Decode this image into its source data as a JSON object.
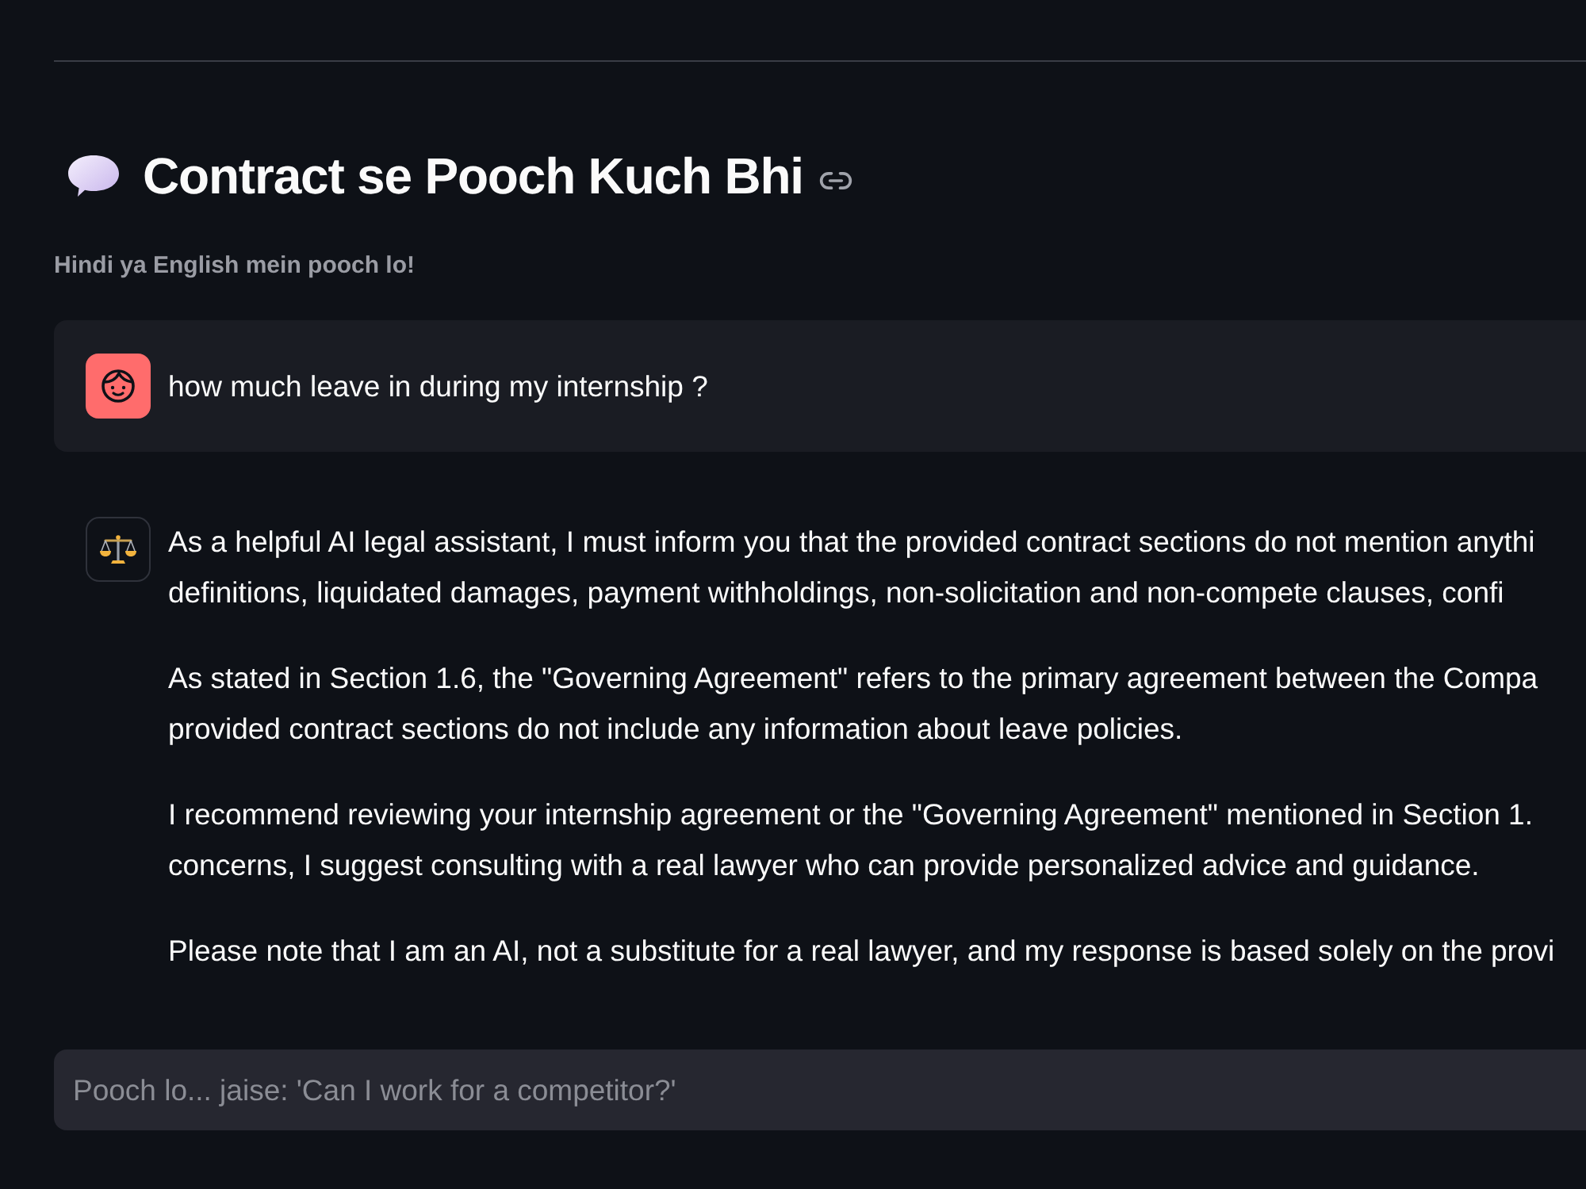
{
  "header": {
    "title": "Contract se Pooch Kuch Bhi",
    "subtitle": "Hindi ya English mein pooch lo!"
  },
  "messages": [
    {
      "kind": "user",
      "text": "how much leave in during my internship ?"
    },
    {
      "kind": "assistant",
      "paragraphs": [
        {
          "lines": [
            "As a helpful AI legal assistant, I must inform you that the provided contract sections do not mention anythi",
            "definitions, liquidated damages, payment withholdings, non-solicitation and non-compete clauses, confi"
          ]
        },
        {
          "lines": [
            "As stated in Section 1.6, the \"Governing Agreement\" refers to the primary agreement between the Compa",
            "provided contract sections do not include any information about leave policies."
          ]
        },
        {
          "lines": [
            "I recommend reviewing your internship agreement or the \"Governing Agreement\" mentioned in Section 1.",
            "concerns, I suggest consulting with a real lawyer who can provide personalized advice and guidance."
          ]
        },
        {
          "lines": [
            "Please note that I am an AI, not a substitute for a real lawyer, and my response is based solely on the provi"
          ]
        }
      ]
    }
  ],
  "chat_input": {
    "placeholder": "Pooch lo... jaise: 'Can I work for a competitor?'"
  }
}
